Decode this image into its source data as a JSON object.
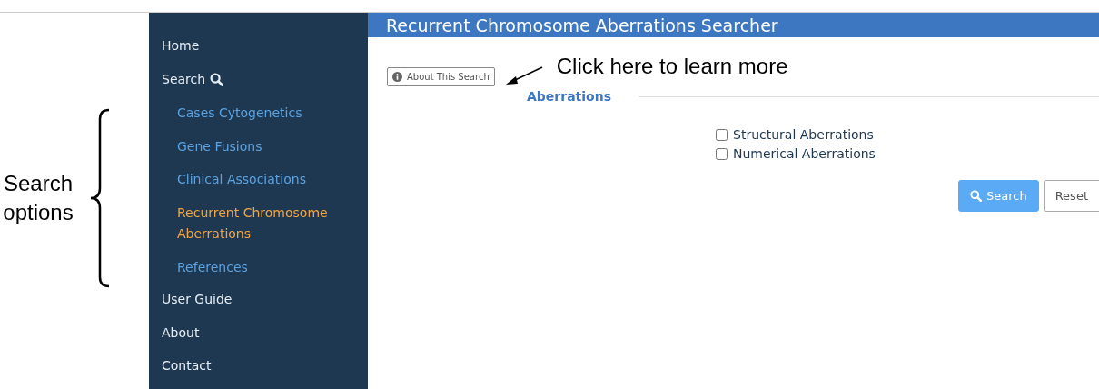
{
  "sidebar": {
    "items": [
      {
        "label": "Home",
        "kind": "link",
        "selected": false
      },
      {
        "label": "Search",
        "kind": "group",
        "selected": false,
        "children": [
          {
            "label": "Cases Cytogenetics",
            "selected": false
          },
          {
            "label": "Gene Fusions",
            "selected": false
          },
          {
            "label": "Clinical Associations",
            "selected": false
          },
          {
            "label": "Recurrent Chromosome Aberrations",
            "selected": true
          },
          {
            "label": "References",
            "selected": false
          }
        ]
      },
      {
        "label": "User Guide",
        "kind": "link",
        "selected": false
      },
      {
        "label": "About",
        "kind": "link",
        "selected": false
      },
      {
        "label": "Contact",
        "kind": "link",
        "selected": false
      }
    ]
  },
  "header": {
    "title": "Recurrent Chromosome Aberrations Searcher"
  },
  "about_button": {
    "label": "About This Search"
  },
  "section": {
    "legend": "Aberrations",
    "options": [
      {
        "label": "Structural Aberrations",
        "checked": false
      },
      {
        "label": "Numerical Aberrations",
        "checked": false
      }
    ]
  },
  "buttons": [
    {
      "label": "Search",
      "kind": "primary"
    },
    {
      "label": "Reset",
      "kind": "secondary"
    }
  ],
  "annotations": [
    {
      "kind": "arrow",
      "text": "Click here to learn more"
    },
    {
      "kind": "brace",
      "text": "Search options"
    }
  ]
}
